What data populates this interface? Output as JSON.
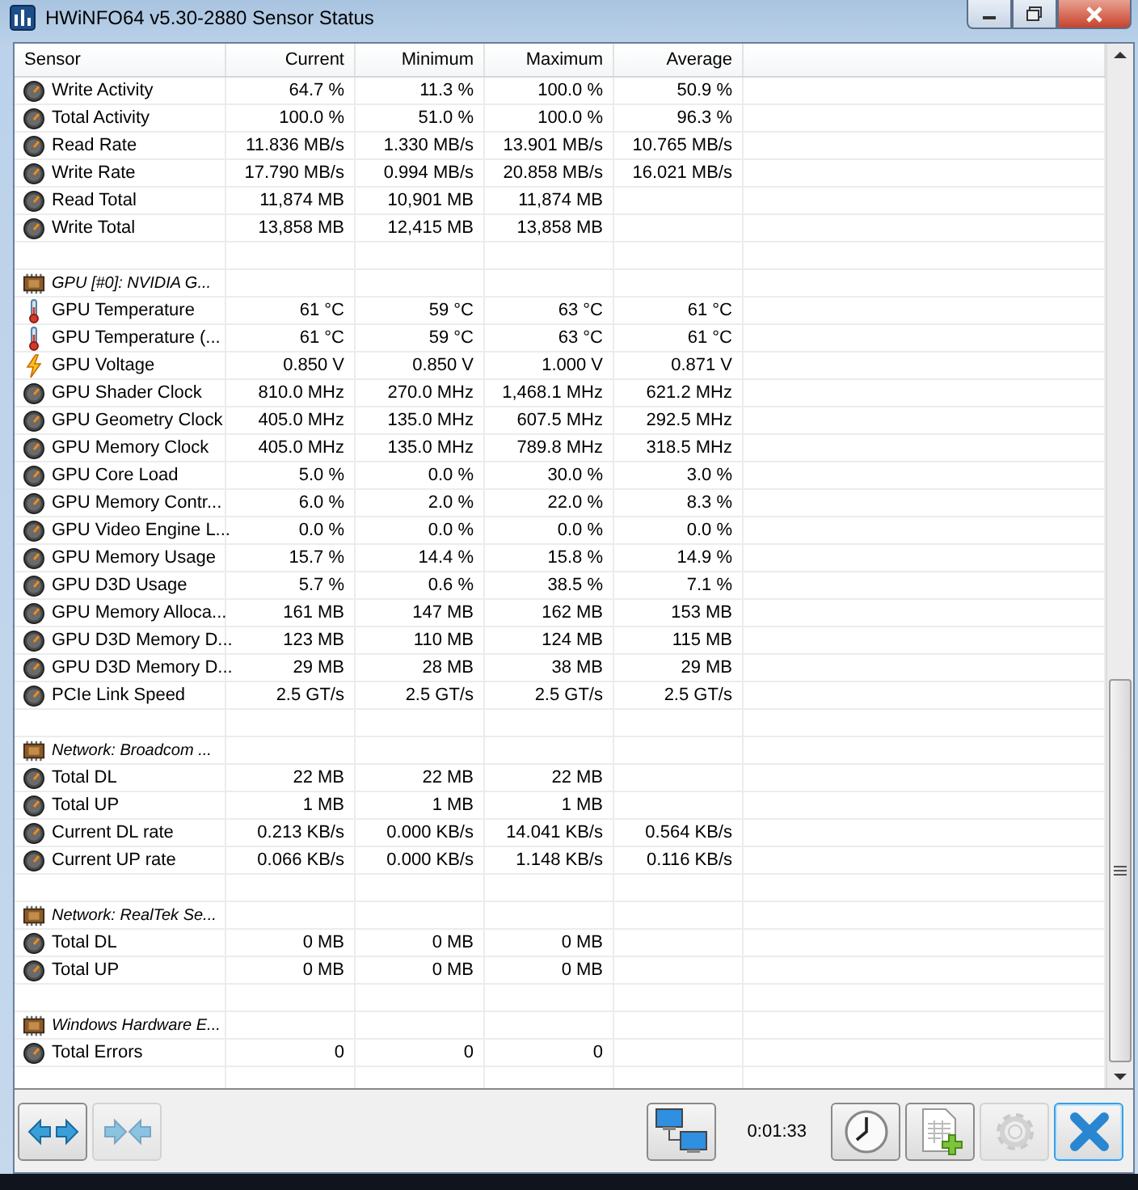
{
  "window": {
    "title": "HWiNFO64 v5.30-2880 Sensor Status"
  },
  "table": {
    "columns": [
      "Sensor",
      "Current",
      "Minimum",
      "Maximum",
      "Average"
    ],
    "rows": [
      {
        "kind": "gauge",
        "name": "Write Activity",
        "values": [
          "64.7 %",
          "11.3 %",
          "100.0 %",
          "50.9 %"
        ]
      },
      {
        "kind": "gauge",
        "name": "Total Activity",
        "values": [
          "100.0 %",
          "51.0 %",
          "100.0 %",
          "96.3 %"
        ]
      },
      {
        "kind": "gauge",
        "name": "Read Rate",
        "values": [
          "11.836 MB/s",
          "1.330 MB/s",
          "13.901 MB/s",
          "10.765 MB/s"
        ]
      },
      {
        "kind": "gauge",
        "name": "Write Rate",
        "values": [
          "17.790 MB/s",
          "0.994 MB/s",
          "20.858 MB/s",
          "16.021 MB/s"
        ]
      },
      {
        "kind": "gauge",
        "name": "Read Total",
        "values": [
          "11,874 MB",
          "10,901 MB",
          "11,874 MB"
        ]
      },
      {
        "kind": "gauge",
        "name": "Write Total",
        "values": [
          "13,858 MB",
          "12,415 MB",
          "13,858 MB"
        ]
      },
      {
        "kind": "spacer"
      },
      {
        "kind": "group",
        "name": "GPU [#0]: NVIDIA G..."
      },
      {
        "kind": "thermometer",
        "name": "GPU Temperature",
        "values": [
          "61 °C",
          "59 °C",
          "63 °C",
          "61 °C"
        ]
      },
      {
        "kind": "thermometer",
        "name": "GPU Temperature (...",
        "values": [
          "61 °C",
          "59 °C",
          "63 °C",
          "61 °C"
        ]
      },
      {
        "kind": "voltage",
        "name": "GPU Voltage",
        "values": [
          "0.850 V",
          "0.850 V",
          "1.000 V",
          "0.871 V"
        ]
      },
      {
        "kind": "gauge",
        "name": "GPU Shader Clock",
        "values": [
          "810.0 MHz",
          "270.0 MHz",
          "1,468.1 MHz",
          "621.2 MHz"
        ]
      },
      {
        "kind": "gauge",
        "name": "GPU Geometry Clock",
        "values": [
          "405.0 MHz",
          "135.0 MHz",
          "607.5 MHz",
          "292.5 MHz"
        ]
      },
      {
        "kind": "gauge",
        "name": "GPU Memory Clock",
        "values": [
          "405.0 MHz",
          "135.0 MHz",
          "789.8 MHz",
          "318.5 MHz"
        ]
      },
      {
        "kind": "gauge",
        "name": "GPU Core Load",
        "values": [
          "5.0 %",
          "0.0 %",
          "30.0 %",
          "3.0 %"
        ]
      },
      {
        "kind": "gauge",
        "name": "GPU Memory Contr...",
        "values": [
          "6.0 %",
          "2.0 %",
          "22.0 %",
          "8.3 %"
        ]
      },
      {
        "kind": "gauge",
        "name": "GPU Video Engine L...",
        "values": [
          "0.0 %",
          "0.0 %",
          "0.0 %",
          "0.0 %"
        ]
      },
      {
        "kind": "gauge",
        "name": "GPU Memory Usage",
        "values": [
          "15.7 %",
          "14.4 %",
          "15.8 %",
          "14.9 %"
        ]
      },
      {
        "kind": "gauge",
        "name": "GPU D3D Usage",
        "values": [
          "5.7 %",
          "0.6 %",
          "38.5 %",
          "7.1 %"
        ]
      },
      {
        "kind": "gauge",
        "name": "GPU Memory Alloca...",
        "values": [
          "161 MB",
          "147 MB",
          "162 MB",
          "153 MB"
        ]
      },
      {
        "kind": "gauge",
        "name": "GPU D3D Memory D...",
        "values": [
          "123 MB",
          "110 MB",
          "124 MB",
          "115 MB"
        ]
      },
      {
        "kind": "gauge",
        "name": "GPU D3D Memory D...",
        "values": [
          "29 MB",
          "28 MB",
          "38 MB",
          "29 MB"
        ]
      },
      {
        "kind": "gauge",
        "name": "PCIe Link Speed",
        "values": [
          "2.5 GT/s",
          "2.5 GT/s",
          "2.5 GT/s",
          "2.5 GT/s"
        ]
      },
      {
        "kind": "spacer"
      },
      {
        "kind": "group",
        "name": "Network: Broadcom ..."
      },
      {
        "kind": "gauge",
        "name": "Total DL",
        "values": [
          "22 MB",
          "22 MB",
          "22 MB"
        ]
      },
      {
        "kind": "gauge",
        "name": "Total UP",
        "values": [
          "1 MB",
          "1 MB",
          "1 MB"
        ]
      },
      {
        "kind": "gauge",
        "name": "Current DL rate",
        "values": [
          "0.213 KB/s",
          "0.000 KB/s",
          "14.041 KB/s",
          "0.564 KB/s"
        ]
      },
      {
        "kind": "gauge",
        "name": "Current UP rate",
        "values": [
          "0.066 KB/s",
          "0.000 KB/s",
          "1.148 KB/s",
          "0.116 KB/s"
        ]
      },
      {
        "kind": "spacer"
      },
      {
        "kind": "group",
        "name": "Network: RealTek Se..."
      },
      {
        "kind": "gauge",
        "name": "Total DL",
        "values": [
          "0 MB",
          "0 MB",
          "0 MB"
        ]
      },
      {
        "kind": "gauge",
        "name": "Total UP",
        "values": [
          "0 MB",
          "0 MB",
          "0 MB"
        ]
      },
      {
        "kind": "spacer"
      },
      {
        "kind": "group",
        "name": "Windows Hardware E..."
      },
      {
        "kind": "gauge",
        "name": "Total Errors",
        "values": [
          "0",
          "0",
          "0"
        ]
      },
      {
        "kind": "spacer"
      },
      {
        "kind": "spacer"
      }
    ]
  },
  "toolbar": {
    "buttons": [
      {
        "kind": "expand",
        "disabled": false
      },
      {
        "kind": "collapse",
        "disabled": true
      },
      {
        "kind": "network",
        "disabled": false
      },
      {
        "kind": "timer-text",
        "text": "0:01:33"
      },
      {
        "kind": "clock",
        "disabled": false
      },
      {
        "kind": "report",
        "disabled": false
      },
      {
        "kind": "settings",
        "disabled": true
      },
      {
        "kind": "close",
        "disabled": false
      }
    ]
  }
}
